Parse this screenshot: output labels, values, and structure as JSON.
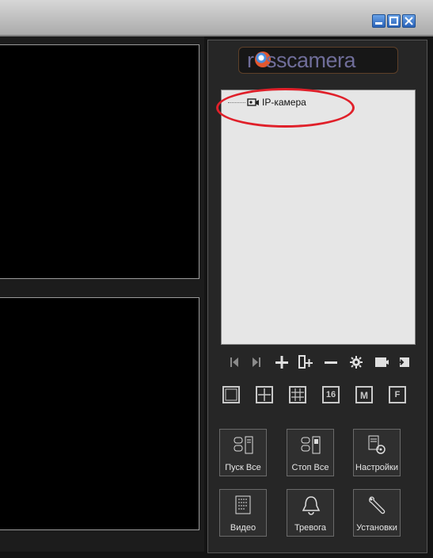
{
  "logo": {
    "text": "rosscamera",
    "letter": "r",
    "rest": "sscamera"
  },
  "tree": {
    "items": [
      {
        "label": "IP-камера",
        "icon": "camera-icon"
      }
    ],
    "highlight_color": "#e0202a"
  },
  "window_controls": {
    "icons": [
      "minimize-icon",
      "maximize-icon",
      "close-icon"
    ]
  },
  "toolbar": {
    "icons": [
      "skip-start-icon",
      "skip-end-icon",
      "add-icon",
      "add-device-icon",
      "remove-icon",
      "gear-icon",
      "edit-icon",
      "export-icon"
    ]
  },
  "layouts": [
    {
      "label": ""
    },
    {
      "label": ""
    },
    {
      "label": ""
    },
    {
      "label": "16"
    },
    {
      "label": "M"
    },
    {
      "label": "F"
    }
  ],
  "actions": {
    "start_all": "Пуск Все",
    "stop_all": "Стоп Все",
    "settings": "Настройки",
    "video": "Видео",
    "alarm": "Тревога",
    "setup": "Установки"
  },
  "colors": {
    "background": "#141414",
    "panel": "#262626",
    "accent": "#6f6d99"
  }
}
